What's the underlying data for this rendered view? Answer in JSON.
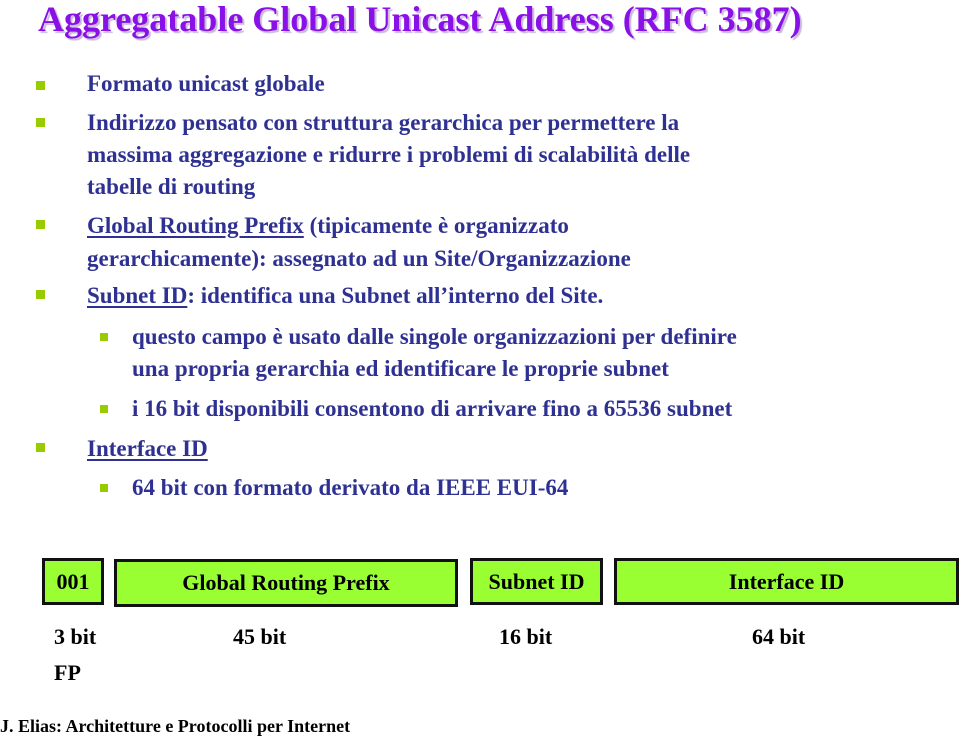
{
  "title": "Aggregatable Global Unicast Address (RFC 3587)",
  "bullets": [
    {
      "text": "Formato unicast globale"
    },
    {
      "lines": [
        "Indirizzo pensato con struttura gerarchica per permettere la",
        "massima aggregazione e ridurre i problemi di scalabilità delle",
        "tabelle di routing"
      ]
    },
    {
      "term": "Global Routing Prefix",
      "rest_line1": " (tipicamente è organizzato",
      "line2": "gerarchicamente): assegnato ad un Site/Organizzazione"
    },
    {
      "term": "Subnet ID",
      "rest": ": identifica una Subnet all’interno del Site.",
      "subitems": [
        {
          "lines": [
            "questo campo è usato dalle singole organizzazioni per definire",
            "una propria gerarchia ed identificare le proprie subnet"
          ]
        },
        {
          "text": "i 16 bit disponibili consentono di arrivare fino a 65536 subnet"
        }
      ]
    },
    {
      "term": "Interface ID",
      "subitems": [
        {
          "text": "64 bit con formato derivato da IEEE EUI-64"
        }
      ]
    }
  ],
  "address_format": {
    "fields": [
      {
        "label": "001",
        "bits": "3 bit",
        "note": "FP"
      },
      {
        "label": "Global Routing Prefix",
        "bits": "45 bit"
      },
      {
        "label": "Subnet ID",
        "bits": "16 bit"
      },
      {
        "label": "Interface ID",
        "bits": "64 bit"
      }
    ],
    "field_color": "#99ff33"
  },
  "footer": "J. Elias: Architetture e Protocolli per Internet",
  "colors": {
    "title": "#8a10e8",
    "body_text": "#2e3192",
    "bullet": "#99cc00"
  }
}
